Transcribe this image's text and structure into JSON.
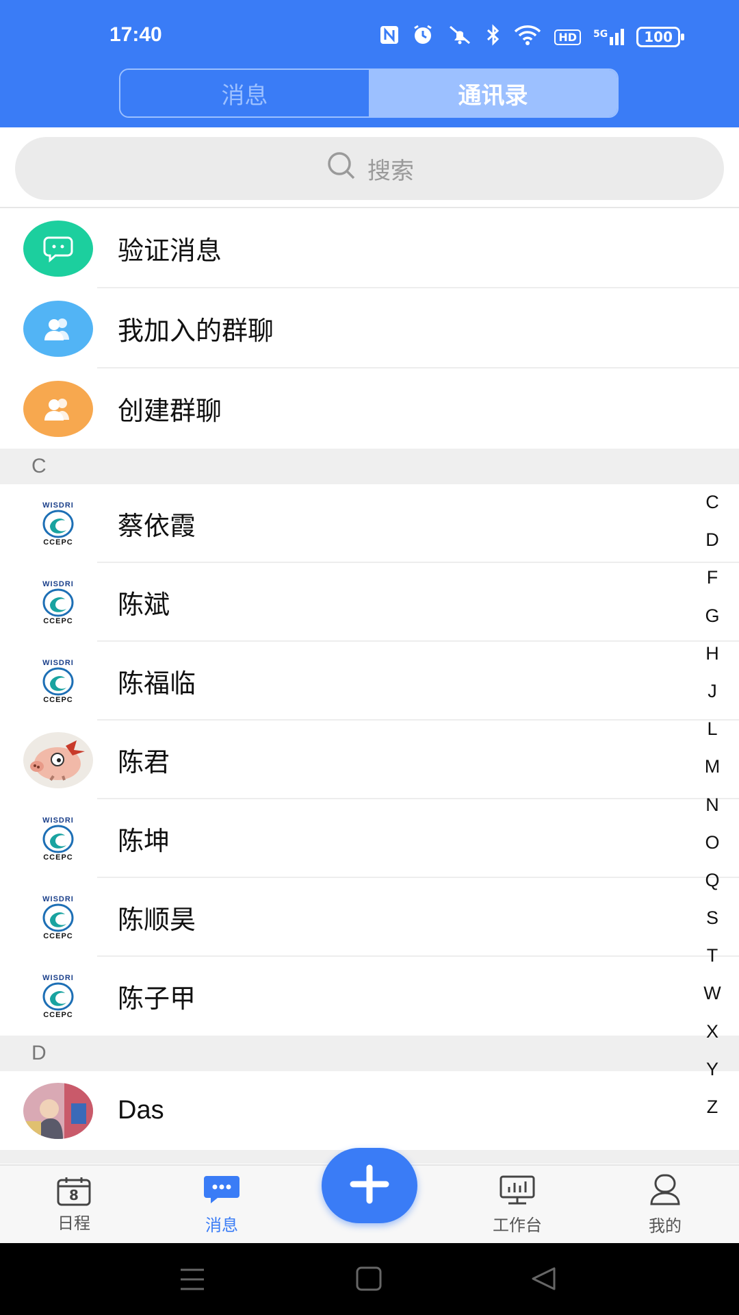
{
  "status_bar": {
    "time": "17:40",
    "nfc_icon": "nfc-icon",
    "alarm_icon": "alarm-icon",
    "mute_icon": "bell-off-icon",
    "bluetooth_icon": "bluetooth-icon",
    "wifi_icon": "wifi-icon",
    "hd": "HD",
    "signal": "5G",
    "battery": "100"
  },
  "segmented_tabs": {
    "messages": "消息",
    "contacts": "通讯录",
    "active": "contacts"
  },
  "search": {
    "placeholder": "搜索"
  },
  "special_items": [
    {
      "label": "验证消息",
      "icon": "chat-bubble-icon",
      "color": "#1ccf9e"
    },
    {
      "label": "我加入的群聊",
      "icon": "group-icon",
      "color": "#52b4f5"
    },
    {
      "label": "创建群聊",
      "icon": "group-add-icon",
      "color": "#f7a84f"
    }
  ],
  "sections": [
    {
      "letter": "C",
      "contacts": [
        {
          "name": "蔡依霞",
          "avatar": "company-logo"
        },
        {
          "name": "陈斌",
          "avatar": "company-logo"
        },
        {
          "name": "陈福临",
          "avatar": "company-logo"
        },
        {
          "name": "陈君",
          "avatar": "pig-cartoon"
        },
        {
          "name": "陈坤",
          "avatar": "company-logo"
        },
        {
          "name": "陈顺昊",
          "avatar": "company-logo"
        },
        {
          "name": "陈子甲",
          "avatar": "company-logo"
        }
      ]
    },
    {
      "letter": "D",
      "contacts": [
        {
          "name": "Das",
          "avatar": "photo"
        }
      ]
    }
  ],
  "logo_text": {
    "top": "WISDRI",
    "bottom": "CCEPC"
  },
  "index_letters": [
    "C",
    "D",
    "F",
    "G",
    "H",
    "J",
    "L",
    "M",
    "N",
    "O",
    "Q",
    "S",
    "T",
    "W",
    "X",
    "Y",
    "Z"
  ],
  "bottom_nav": {
    "schedule": "日程",
    "calendar_day": "8",
    "messages": "消息",
    "workbench": "工作台",
    "mine": "我的",
    "active": "messages",
    "accent_color": "#3a7cf6"
  }
}
